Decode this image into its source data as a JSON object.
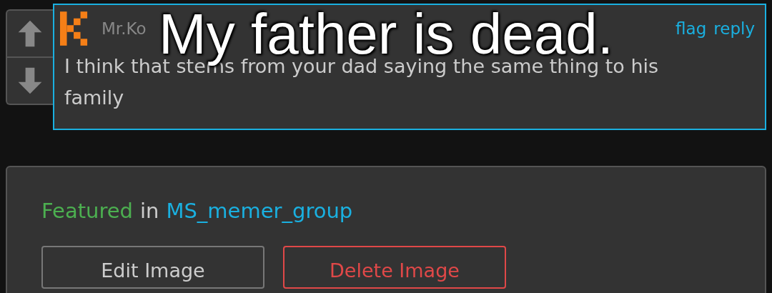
{
  "caption": "My father is dead.",
  "comment": {
    "username": "Mr.Ko",
    "actions": [
      "flag",
      "reply"
    ],
    "text": "I think that stems from your dad saying the same thing to his family"
  },
  "featured": {
    "label": "Featured",
    "joiner": "in",
    "group": "MS_memer_group"
  },
  "buttons": [
    {
      "label": "Edit Image",
      "kind": "edit"
    },
    {
      "label": "Delete Image",
      "kind": "danger"
    }
  ]
}
